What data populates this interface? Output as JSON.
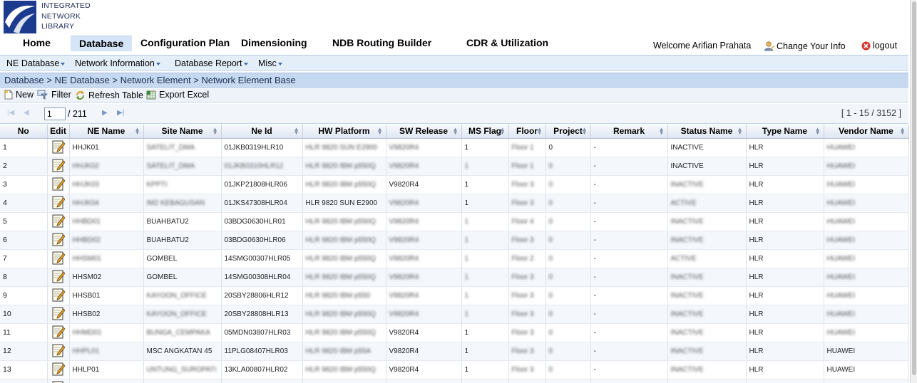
{
  "logo": {
    "line1": "INTEGRATED",
    "line2": "NETWORK",
    "line3": "LIBRARY"
  },
  "mainnav": {
    "home": "Home",
    "database": "Database",
    "configuration_plan": "Configuration Plan",
    "dimensioning": "Dimensioning",
    "ndb_routing_builder": "NDB Routing Builder",
    "cdr_utilization": "CDR & Utilization"
  },
  "user": {
    "welcome": "Welcome Arifian Prahata",
    "change_info": "Change Your Info",
    "logout": "logout"
  },
  "subnav": {
    "ne_database": "NE Database",
    "network_information": "Network Information",
    "database_report": "Database Report",
    "misc": "Misc"
  },
  "breadcrumb": "Database > NE Database > Network Element > Network Element Base",
  "toolbar": {
    "new": "New",
    "filter": "Filter",
    "refresh": "Refresh Table",
    "export": "Export Excel"
  },
  "pager": {
    "page_value": "1",
    "total": "/ 211",
    "range": "[ 1 - 15 / 3152 ]"
  },
  "table": {
    "columns": [
      "No",
      "Edit",
      "NE Name",
      "Site Name",
      "Ne Id",
      "HW Platform",
      "SW Release",
      "MS Flag",
      "Floor",
      "Project",
      "Remark",
      "Status Name",
      "Type Name",
      "Vendor Name"
    ],
    "rows": [
      {
        "no": "1",
        "ne_name": "HHJK01",
        "site": "SATELIT_DMA",
        "ne_id": "01JKB0319HLR10",
        "hw": "HLR 9820 SUN E2900",
        "sw": "V9820R4",
        "ms": "1",
        "floor": "Floor 1",
        "project": "0",
        "remark": "-",
        "status": "INACTIVE",
        "type": "HLR",
        "vendor": "HUAWEI"
      },
      {
        "no": "2",
        "ne_name": "HHJK02",
        "site": "SATELIT_DMA",
        "ne_id": "01JKB0310HLR12",
        "hw": "HLR 9820 IBM p550Q",
        "sw": "V9820R4",
        "ms": "1",
        "floor": "Floor 1",
        "project": "0",
        "remark": "-",
        "status": "INACTIVE",
        "type": "HLR",
        "vendor": "HUAWEI"
      },
      {
        "no": "3",
        "ne_name": "HHJK03",
        "site": "KPPTI",
        "ne_id": "01JKP21808HLR06",
        "hw": "HLR 9820 IBM p550Q",
        "sw": "V9820R4",
        "ms": "1",
        "floor": "Floor 3",
        "project": "0",
        "remark": "-",
        "status": "INACTIVE",
        "type": "HLR",
        "vendor": "HUAWEI"
      },
      {
        "no": "4",
        "ne_name": "HHJK04",
        "site": "IM2 KEBAGUSAN",
        "ne_id": "01JKS47308HLR04",
        "hw": "HLR 9820 SUN E2900",
        "sw": "V9820R4",
        "ms": "1",
        "floor": "Floor 3",
        "project": "0",
        "remark": "-",
        "status": "ACTIVE",
        "type": "HLR",
        "vendor": "HUAWEI"
      },
      {
        "no": "5",
        "ne_name": "HHBD01",
        "site": "BUAHBATU2",
        "ne_id": "03BDG0630HLR01",
        "hw": "HLR 9820 IBM p550Q",
        "sw": "V9820R4",
        "ms": "1",
        "floor": "Floor 4",
        "project": "0",
        "remark": "-",
        "status": "INACTIVE",
        "type": "HLR",
        "vendor": "HUAWEI"
      },
      {
        "no": "6",
        "ne_name": "HHBD02",
        "site": "BUAHBATU2",
        "ne_id": "03BDG0630HLR06",
        "hw": "HLR 9820 IBM p550Q",
        "sw": "V9820R4",
        "ms": "1",
        "floor": "Floor 3",
        "project": "0",
        "remark": "-",
        "status": "INACTIVE",
        "type": "HLR",
        "vendor": "HUAWEI"
      },
      {
        "no": "7",
        "ne_name": "HHSM01",
        "site": "GOMBEL",
        "ne_id": "14SMG00307HLR05",
        "hw": "HLR 9820 IBM p550Q",
        "sw": "V9820R4",
        "ms": "1",
        "floor": "Floor 2",
        "project": "0",
        "remark": "-",
        "status": "ACTIVE",
        "type": "HLR",
        "vendor": "HUAWEI"
      },
      {
        "no": "8",
        "ne_name": "HHSM02",
        "site": "GOMBEL",
        "ne_id": "14SMG00308HLR04",
        "hw": "HLR 9820 IBM p550Q",
        "sw": "V9820R4",
        "ms": "1",
        "floor": "Floor 3",
        "project": "0",
        "remark": "-",
        "status": "INACTIVE",
        "type": "HLR",
        "vendor": "HUAWEI"
      },
      {
        "no": "9",
        "ne_name": "HHSB01",
        "site": "KAYOON_OFFICE",
        "ne_id": "20SBY28806HLR12",
        "hw": "HLR 9820 IBM p550",
        "sw": "V9820R4",
        "ms": "1",
        "floor": "Floor 3",
        "project": "0",
        "remark": "-",
        "status": "INACTIVE",
        "type": "HLR",
        "vendor": "HUAWEI"
      },
      {
        "no": "10",
        "ne_name": "HHSB02",
        "site": "KAYOON_OFFICE",
        "ne_id": "20SBY28808HLR13",
        "hw": "HLR 9820 IBM p550Q",
        "sw": "V9820R4",
        "ms": "1",
        "floor": "Floor 3",
        "project": "0",
        "remark": "-",
        "status": "INACTIVE",
        "type": "HLR",
        "vendor": "HUAWEI"
      },
      {
        "no": "11",
        "ne_name": "HHMD01",
        "site": "BUNGA_CEMPAKA",
        "ne_id": "05MDN03807HLR03",
        "hw": "HLR 9820 IBM p550Q",
        "sw": "V9820R4",
        "ms": "1",
        "floor": "Floor 3",
        "project": "0",
        "remark": "-",
        "status": "INACTIVE",
        "type": "HLR",
        "vendor": "HUAWEI"
      },
      {
        "no": "12",
        "ne_name": "HHPL01",
        "site": "MSC ANGKATAN 45",
        "ne_id": "11PLG08407HLR03",
        "hw": "HLR 9820 IBM p55A",
        "sw": "V9820R4",
        "ms": "1",
        "floor": "Floor 3",
        "project": "0",
        "remark": "-",
        "status": "INACTIVE",
        "type": "HLR",
        "vendor": "HUAWEI"
      },
      {
        "no": "13",
        "ne_name": "HHLP01",
        "site": "UNTUNG_SUROPATI",
        "ne_id": "13KLA00807HLR02",
        "hw": "HLR 9820 IBM p550Q",
        "sw": "V9820R4",
        "ms": "1",
        "floor": "Floor 3",
        "project": "0",
        "remark": "-",
        "status": "INACTIVE",
        "type": "HLR",
        "vendor": "HUAWEI"
      },
      {
        "no": "",
        "ne_name": "",
        "site": "",
        "ne_id": "",
        "hw": "",
        "sw": "",
        "ms": "",
        "floor": "",
        "project": "",
        "remark": "",
        "status": "",
        "type": "",
        "vendor": ""
      }
    ]
  }
}
